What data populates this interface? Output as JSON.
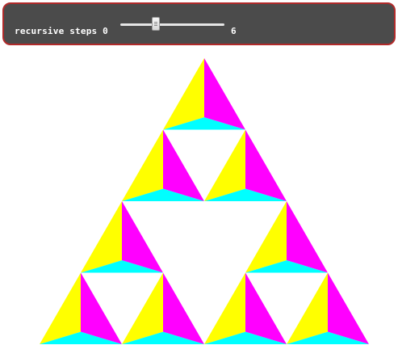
{
  "controls": {
    "label": "recursive steps",
    "min": "0",
    "max": "6",
    "current": 2
  },
  "fractal": {
    "colors": {
      "yellow": "#ffff00",
      "magenta": "#ff00ff",
      "cyan": "#00ffff",
      "white": "#ffffff"
    }
  }
}
